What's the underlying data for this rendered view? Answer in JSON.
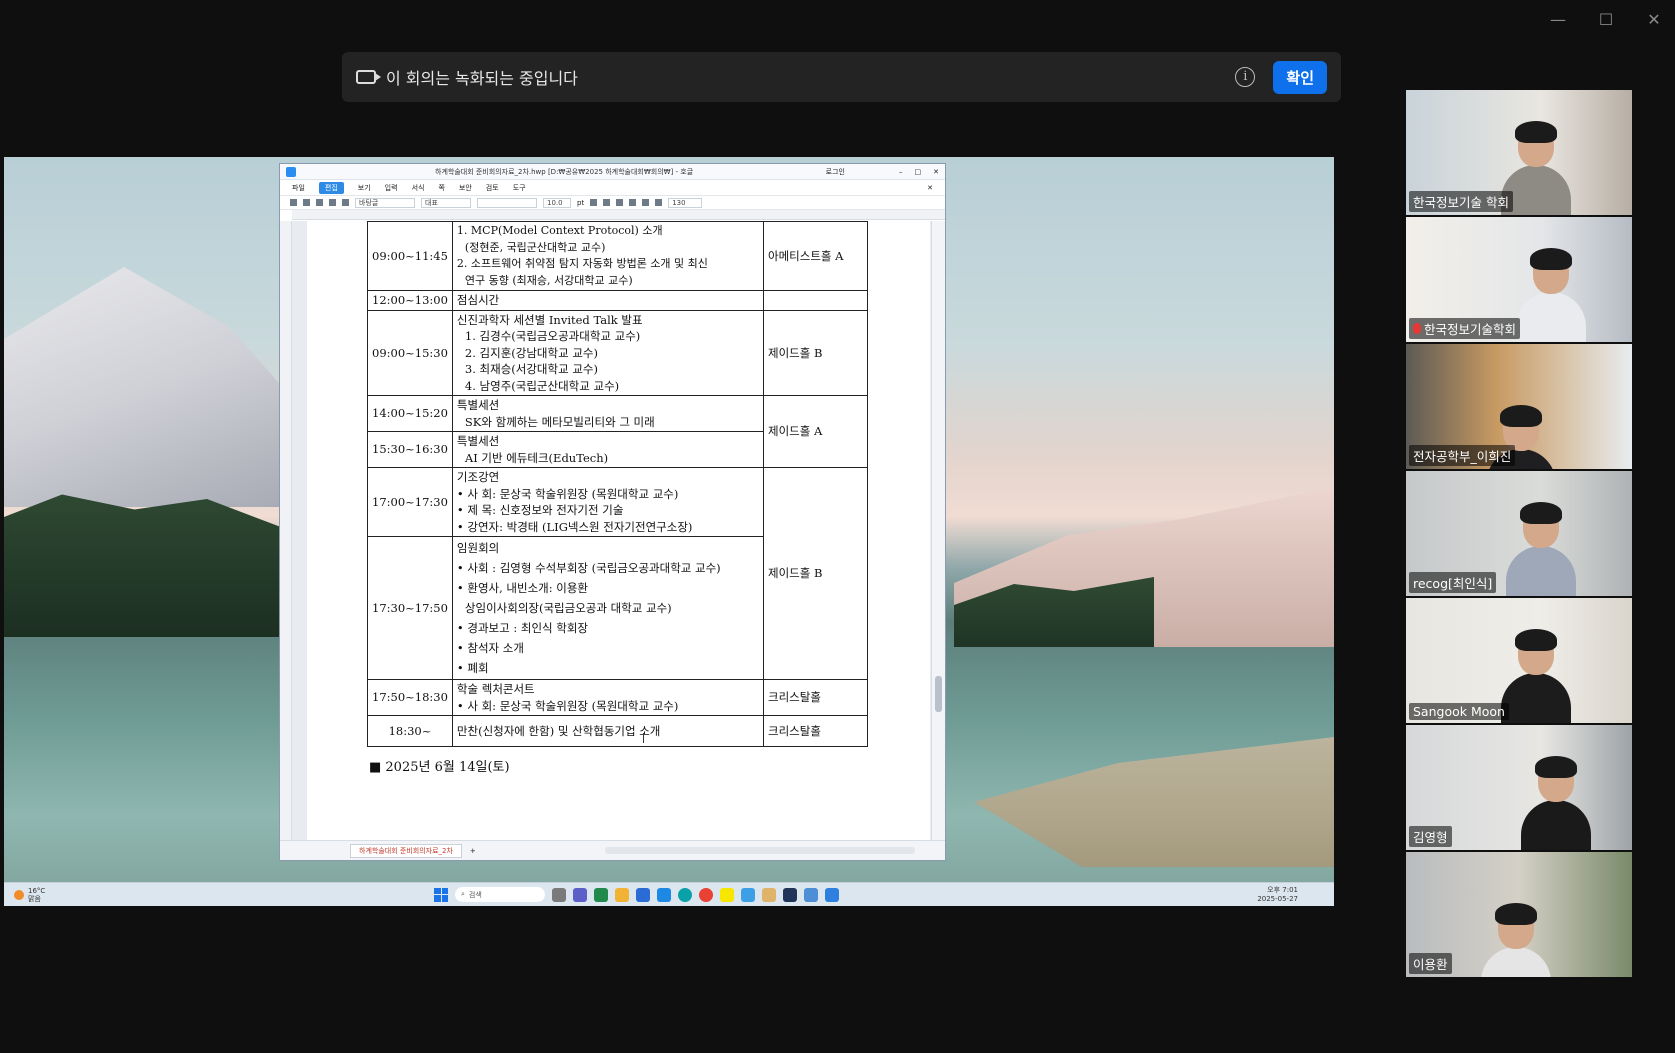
{
  "recording_banner": {
    "message": "이 회의는 녹화되는 중입니다",
    "confirm_label": "확인"
  },
  "window_controls": {
    "minimize": "—",
    "maximize": "☐",
    "close": "✕"
  },
  "hwp": {
    "doc_title": "하계학술대회 준비회의자료_2차.hwp [D:₩공유₩2025 하계학술대회₩회의₩] - 호글",
    "login": "로그인",
    "menus": [
      "파일",
      "편집",
      "보기",
      "입력",
      "서식",
      "쪽",
      "보안",
      "검토",
      "도구"
    ],
    "style_box": "바탕글",
    "font_box": "대표",
    "size_box": "10.0",
    "unit_box": "pt",
    "zoom_box": "130",
    "doc_tab": "하계학술대회 준비회의자료_2차"
  },
  "schedule": [
    {
      "time": "09:00~11:45",
      "content": [
        "1. MCP(Model Context Protocol) 소개",
        "(정현준, 국립군산대학교 교수)",
        "2. 소프트웨어 취약점 탐지 자동화 방법론 소개 및 최신",
        "연구 동향 (최재승, 서강대학교 교수)"
      ],
      "room": "아메티스트홀 A"
    },
    {
      "time": "12:00~13:00",
      "content": [
        "점심시간"
      ],
      "room": ""
    },
    {
      "time": "09:00~15:30",
      "content": [
        "신진과학자 세션별 Invited Talk 발표",
        "1. 김경수(국립금오공과대학교 교수)",
        "2. 김지훈(강남대학교 교수)",
        "3. 최재승(서강대학교 교수)",
        "4. 남영주(국립군산대학교 교수)"
      ],
      "room": "제이드홀 B"
    },
    {
      "time": "14:00~15:20",
      "content": [
        "특별세션",
        "SK와 함께하는 메타모빌리티와 그 미래"
      ],
      "room": "제이드홀 A"
    },
    {
      "time": "15:30~16:30",
      "content": [
        "특별세션",
        "AI 기반 에듀테크(EduTech)"
      ],
      "room": ""
    },
    {
      "time": "17:00~17:30",
      "content": [
        "기조강연",
        "• 사 회: 문상국 학술위원장 (목원대학교 교수)",
        "• 제 목: 신호정보와 전자기전 기술",
        "• 강연자: 박경태 (LIG넥스원 전자기전연구소장)"
      ],
      "room": "제이드홀 B"
    },
    {
      "time": "17:30~17:50",
      "content": [
        "임원회의",
        "• 사회 : 김영형 수석부회장 (국립금오공과대학교 교수)",
        "• 환영사, 내빈소개: 이용환",
        "상임이사회의장(국립금오공과 대학교 교수)",
        "• 경과보고 : 최인식 학회장",
        "• 참석자 소개",
        "• 폐회"
      ],
      "room": ""
    },
    {
      "time": "17:50~18:30",
      "content": [
        "학술 렉처콘서트",
        "• 사 회: 문상국 학술위원장 (목원대학교 교수)"
      ],
      "room": "크리스탈홀"
    },
    {
      "time": "18:30~",
      "content": [
        "만찬(신청자에 한함) 및 산학협동기업 소개"
      ],
      "room": "크리스탈홀"
    }
  ],
  "date_heading": "■ 2025년 6월 14일(토)",
  "taskbar": {
    "temp": "16°C",
    "weather": "맑음",
    "search": "검색",
    "time": "오후 7:01",
    "date": "2025-05-27"
  },
  "participants": [
    {
      "name": "한국정보기술 학회",
      "muted": false
    },
    {
      "name": "한국정보기술학회",
      "muted": true
    },
    {
      "name": "전자공학부_이희진",
      "muted": false
    },
    {
      "name": "recog[최인식]",
      "muted": false
    },
    {
      "name": "Sangook Moon",
      "muted": false,
      "active": true
    },
    {
      "name": "김영형",
      "muted": false
    },
    {
      "name": "이용환",
      "muted": false
    }
  ],
  "colors": {
    "accent": "#0e71eb",
    "active_speaker": "#23d160"
  }
}
